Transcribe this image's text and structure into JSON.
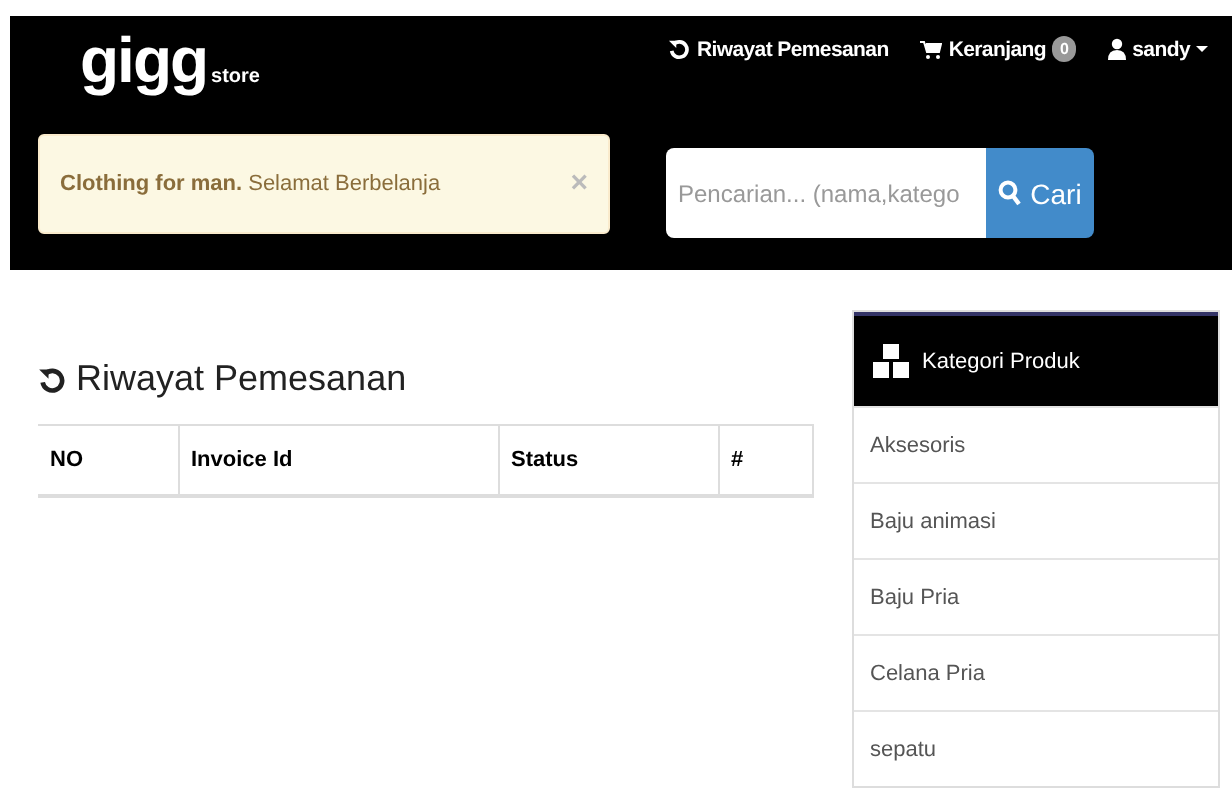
{
  "navbar": {
    "logo": "gigg",
    "logo_suffix": "store",
    "links": [
      {
        "kind": "history",
        "label": "Riwayat Pemesanan"
      },
      {
        "kind": "cart",
        "label": "Keranjang",
        "badge": "0"
      },
      {
        "kind": "user",
        "label": "sandy"
      }
    ]
  },
  "alert": {
    "text": "**Clothing for man.** Selamat Berbelanja",
    "close": "×"
  },
  "search": {
    "placeholder": "Pencarian... (nama,katego",
    "button": "Cari"
  },
  "page_title": "Riwayat Pemesanan",
  "table": {
    "columns": [
      "NO",
      "Invoice Id",
      "Status",
      "#"
    ]
  },
  "sidebar": {
    "title": "Kategori Produk",
    "items": [
      "Aksesoris",
      "Baju animasi",
      "Baju Pria",
      "Celana Pria",
      "sepatu"
    ]
  }
}
